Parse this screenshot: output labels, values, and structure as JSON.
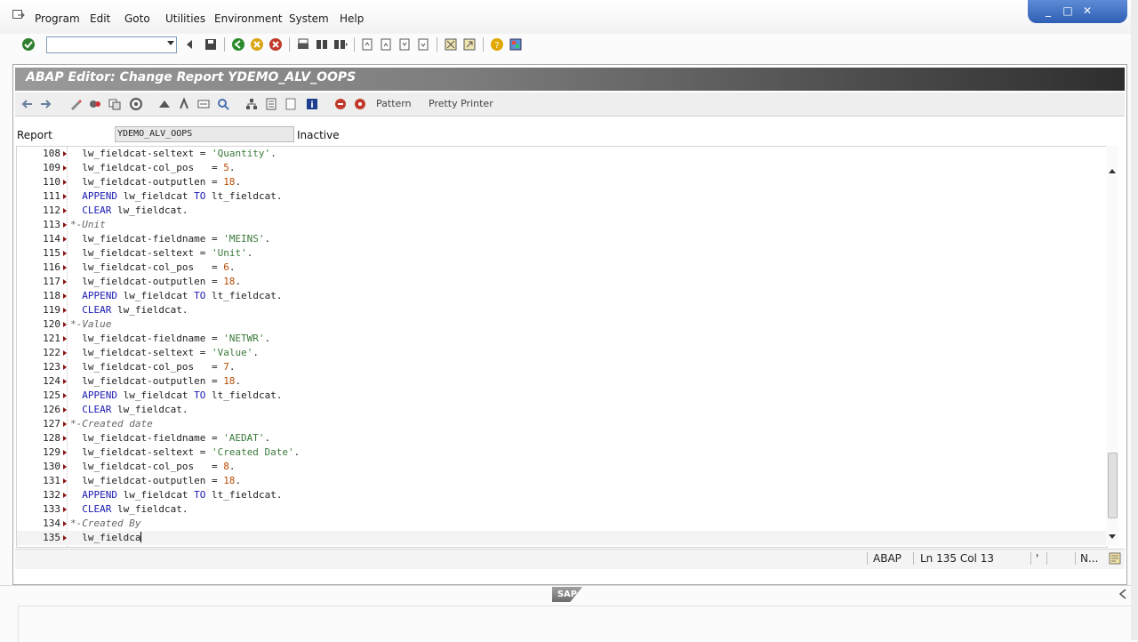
{
  "menu": [
    "Program",
    "Edit",
    "Goto",
    "Utilities",
    "Environment",
    "System",
    "Help"
  ],
  "window_controls": [
    "_",
    "□",
    "✕"
  ],
  "command_field": {
    "value": ""
  },
  "window_title": "ABAP Editor: Change Report YDEMO_ALV_OOPS",
  "app_toolbar": {
    "pattern_label": "Pattern",
    "pretty_printer_label": "Pretty Printer"
  },
  "report": {
    "label": "Report",
    "value": "YDEMO_ALV_OOPS",
    "status": "Inactive"
  },
  "editor": {
    "lines": [
      {
        "num": "108",
        "code": "  lw_fieldcat-seltext = 'Quantity'."
      },
      {
        "num": "109",
        "code": "  lw_fieldcat-col_pos   = 5."
      },
      {
        "num": "110",
        "code": "  lw_fieldcat-outputlen = 18."
      },
      {
        "num": "111",
        "code": "  APPEND lw_fieldcat TO lt_fieldcat."
      },
      {
        "num": "112",
        "code": "  CLEAR lw_fieldcat."
      },
      {
        "num": "113",
        "code": "*-Unit"
      },
      {
        "num": "114",
        "code": "  lw_fieldcat-fieldname = 'MEINS'."
      },
      {
        "num": "115",
        "code": "  lw_fieldcat-seltext = 'Unit'."
      },
      {
        "num": "116",
        "code": "  lw_fieldcat-col_pos   = 6."
      },
      {
        "num": "117",
        "code": "  lw_fieldcat-outputlen = 18."
      },
      {
        "num": "118",
        "code": "  APPEND lw_fieldcat TO lt_fieldcat."
      },
      {
        "num": "119",
        "code": "  CLEAR lw_fieldcat."
      },
      {
        "num": "120",
        "code": "*-Value"
      },
      {
        "num": "121",
        "code": "  lw_fieldcat-fieldname = 'NETWR'."
      },
      {
        "num": "122",
        "code": "  lw_fieldcat-seltext = 'Value'."
      },
      {
        "num": "123",
        "code": "  lw_fieldcat-col_pos   = 7."
      },
      {
        "num": "124",
        "code": "  lw_fieldcat-outputlen = 18."
      },
      {
        "num": "125",
        "code": "  APPEND lw_fieldcat TO lt_fieldcat."
      },
      {
        "num": "126",
        "code": "  CLEAR lw_fieldcat."
      },
      {
        "num": "127",
        "code": "*-Created date"
      },
      {
        "num": "128",
        "code": "  lw_fieldcat-fieldname = 'AEDAT'."
      },
      {
        "num": "129",
        "code": "  lw_fieldcat-seltext = 'Created Date'."
      },
      {
        "num": "130",
        "code": "  lw_fieldcat-col_pos   = 8."
      },
      {
        "num": "131",
        "code": "  lw_fieldcat-outputlen = 18."
      },
      {
        "num": "132",
        "code": "  APPEND lw_fieldcat TO lt_fieldcat."
      },
      {
        "num": "133",
        "code": "  CLEAR lw_fieldcat."
      },
      {
        "num": "134",
        "code": "*-Created By"
      },
      {
        "num": "135",
        "code": "  lw_fieldca"
      }
    ]
  },
  "statusbar": {
    "language": "ABAP",
    "position": "Ln 135 Col  13",
    "mark": "'",
    "mode": "N..."
  },
  "logo_text": "SAP"
}
